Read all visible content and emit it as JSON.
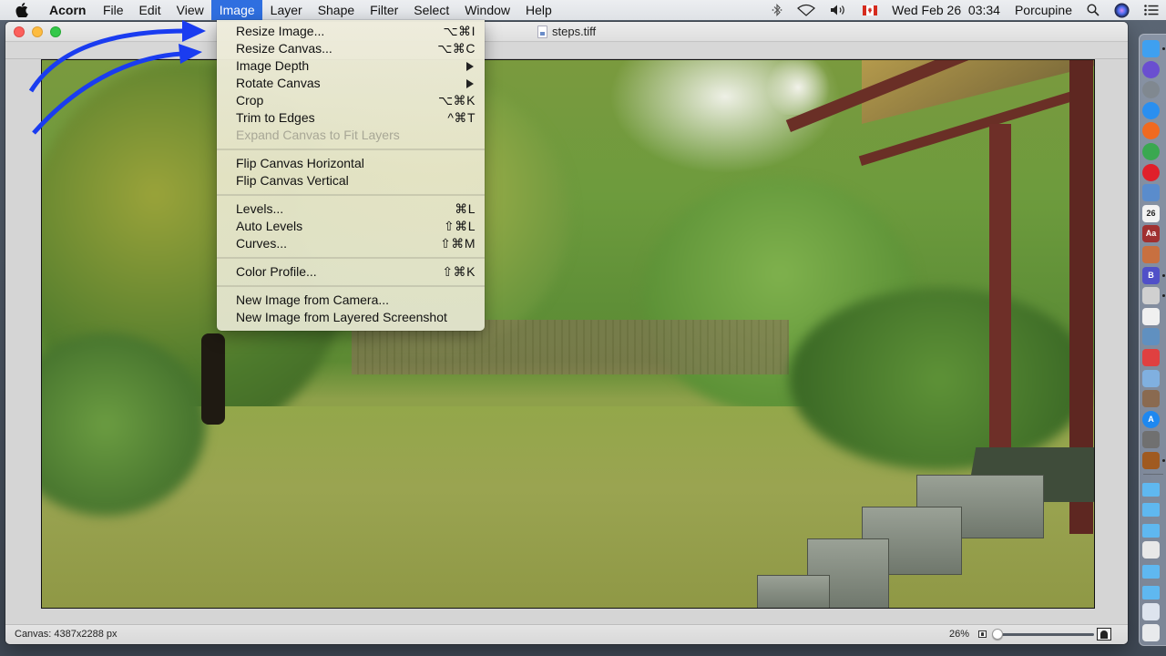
{
  "menubar": {
    "apple_icon": "apple-logo",
    "app_name": "Acorn",
    "menus": [
      "File",
      "Edit",
      "View",
      "Image",
      "Layer",
      "Shape",
      "Filter",
      "Select",
      "Window",
      "Help"
    ],
    "active_menu": "Image",
    "status": {
      "icons": [
        "bluetooth-icon",
        "wifi-icon",
        "volume-icon",
        "canada-flag-input-icon"
      ],
      "datetime": "Wed Feb 26  03:34",
      "user": "Porcupine",
      "right_icons": [
        "spotlight-search-icon",
        "siri-icon",
        "notification-center-icon"
      ]
    }
  },
  "window": {
    "title": "steps.tiff",
    "status_bar": {
      "canvas_info": "Canvas: 4387x2288 px",
      "zoom_level": "26%",
      "zoom_slider_fraction": 0.0
    }
  },
  "image_menu": {
    "items": [
      {
        "label": "Resize Image...",
        "shortcut": "⌥⌘I",
        "enabled": true
      },
      {
        "label": "Resize Canvas...",
        "shortcut": "⌥⌘C",
        "enabled": true
      },
      {
        "label": "Image Depth",
        "submenu": true,
        "enabled": true
      },
      {
        "label": "Rotate Canvas",
        "submenu": true,
        "enabled": true
      },
      {
        "label": "Crop",
        "shortcut": "⌥⌘K",
        "enabled": true
      },
      {
        "label": "Trim to Edges",
        "shortcut": "^⌘T",
        "enabled": true
      },
      {
        "label": "Expand Canvas to Fit Layers",
        "enabled": false
      },
      {
        "separator": true
      },
      {
        "label": "Flip Canvas Horizontal",
        "enabled": true
      },
      {
        "label": "Flip Canvas Vertical",
        "enabled": true
      },
      {
        "separator": true
      },
      {
        "label": "Levels...",
        "shortcut": "⌘L",
        "enabled": true
      },
      {
        "label": "Auto Levels",
        "shortcut": "⇧⌘L",
        "enabled": true
      },
      {
        "label": "Curves...",
        "shortcut": "⇧⌘M",
        "enabled": true
      },
      {
        "separator": true
      },
      {
        "label": "Color Profile...",
        "shortcut": "⇧⌘K",
        "enabled": true
      },
      {
        "separator": true
      },
      {
        "label": "New Image from Camera...",
        "enabled": true
      },
      {
        "label": "New Image from Layered Screenshot",
        "enabled": true
      }
    ]
  },
  "annotation": {
    "arrow_color": "#1a3cf0",
    "arrows_point_to": [
      "Resize Image...",
      "Resize Canvas..."
    ]
  },
  "canvas_image": {
    "description": "Backyard lawn with trees, wooden fence, red pergola and stone steps"
  },
  "dock": {
    "items": [
      {
        "name": "finder",
        "color": "#3fa0f0",
        "running": true
      },
      {
        "name": "siri",
        "color": "#6a4fd0",
        "running": false
      },
      {
        "name": "launchpad",
        "color": "#808890",
        "running": false
      },
      {
        "name": "safari",
        "color": "#2a8ff0",
        "running": false
      },
      {
        "name": "firefox",
        "color": "#f06a20",
        "running": false
      },
      {
        "name": "chrome",
        "color": "#3aa850",
        "running": false
      },
      {
        "name": "opera",
        "color": "#e0202a",
        "running": false
      },
      {
        "name": "mail",
        "color": "#5a8ccc",
        "running": false
      },
      {
        "name": "calendar",
        "color": "#f2f2f2",
        "label": "26",
        "running": false
      },
      {
        "name": "dictionary",
        "color": "#a03030",
        "label": "Aa",
        "running": false
      },
      {
        "name": "notefile",
        "color": "#c87040",
        "running": false
      },
      {
        "name": "bbedit",
        "color": "#5050c8",
        "label": "B",
        "running": true
      },
      {
        "name": "screenshot-tool",
        "color": "#d0d0d0",
        "running": true
      },
      {
        "name": "textedit",
        "color": "#f0f0f0",
        "running": false
      },
      {
        "name": "preview",
        "color": "#6090c0",
        "running": false
      },
      {
        "name": "image-capture",
        "color": "#e04040",
        "running": false
      },
      {
        "name": "maps",
        "color": "#80b0e0",
        "running": false
      },
      {
        "name": "photos",
        "color": "#8a6a50",
        "running": false
      },
      {
        "name": "app-store",
        "color": "#1e88f0",
        "label": "A",
        "running": false
      },
      {
        "name": "system-preferences",
        "color": "#707070",
        "running": false
      },
      {
        "name": "acorn",
        "color": "#a05a20",
        "running": true
      },
      {
        "name": "folder-applications",
        "color": "#5fb8f0",
        "running": false
      },
      {
        "name": "folder-documents",
        "color": "#5fb8f0",
        "running": false
      },
      {
        "name": "folder-downloads",
        "color": "#5fb8f0",
        "running": false
      },
      {
        "name": "document-stack",
        "color": "#e8e8e8",
        "running": false
      },
      {
        "name": "folder-pictures",
        "color": "#5fb8f0",
        "running": false
      },
      {
        "name": "folder-misc",
        "color": "#5fb8f0",
        "running": false
      },
      {
        "name": "screenshot-stack",
        "color": "#dde4ee",
        "running": false
      },
      {
        "name": "trash",
        "color": "#e8eaec",
        "running": false
      }
    ]
  }
}
